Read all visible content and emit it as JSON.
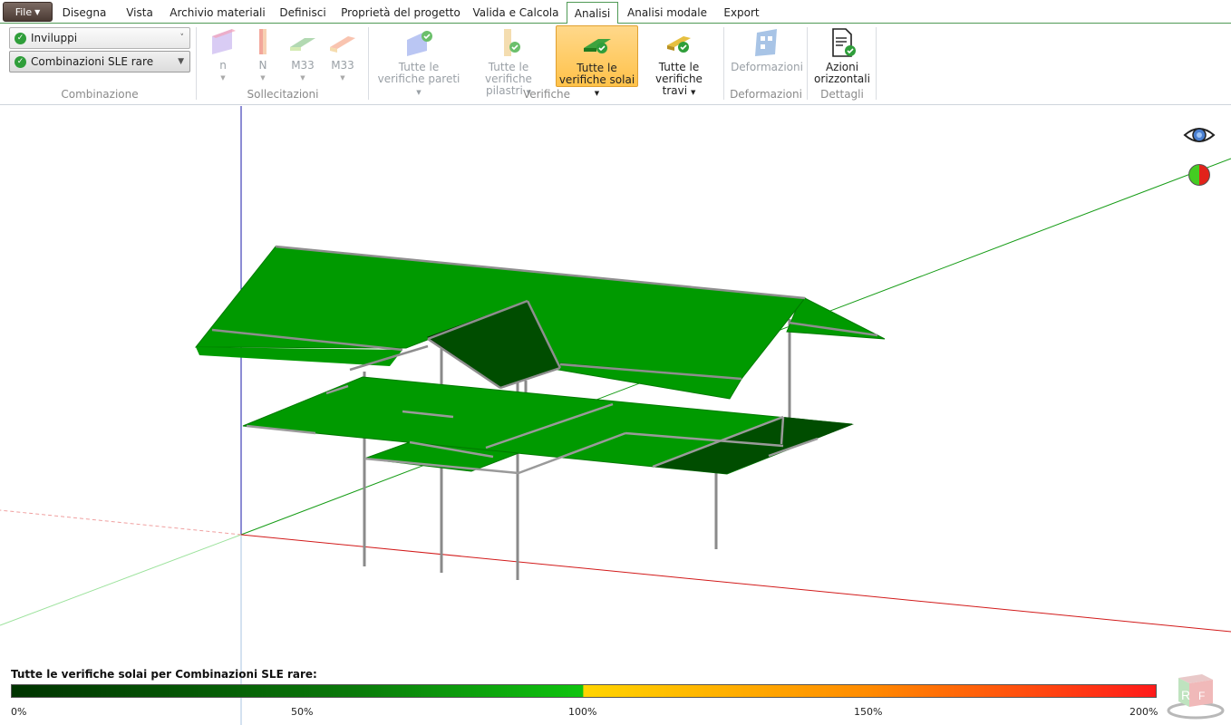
{
  "app": {
    "file_label": "File",
    "tabs": [
      {
        "label": "Disegna"
      },
      {
        "label": "Vista"
      },
      {
        "label": "Archivio materiali"
      },
      {
        "label": "Definisci"
      },
      {
        "label": "Proprietà del progetto"
      },
      {
        "label": "Valida e Calcola"
      },
      {
        "label": "Analisi",
        "active": true
      },
      {
        "label": "Analisi modale"
      },
      {
        "label": "Export"
      }
    ]
  },
  "ribbon": {
    "combinazione": {
      "envelope_select": "Inviluppi",
      "combination_select": "Combinazioni SLE rare",
      "group_label": "Combinazione"
    },
    "sollecitazioni": {
      "buttons": [
        "n",
        "N",
        "M33",
        "M33"
      ],
      "group_label": "Sollecitazioni"
    },
    "verifiche": {
      "walls": [
        "Tutte le",
        "verifiche pareti"
      ],
      "columns": [
        "Tutte le",
        "verifiche pilastri"
      ],
      "slabs": [
        "Tutte le",
        "verifiche solai"
      ],
      "beams": [
        "Tutte le",
        "verifiche travi"
      ],
      "group_label": "Verifiche"
    },
    "deformazioni": {
      "button": "Deformazioni",
      "group_label": "Deformazioni"
    },
    "dettagli": {
      "button": [
        "Azioni",
        "orizzontali"
      ],
      "group_label": "Dettagli"
    }
  },
  "legend": {
    "title": "Tutte le verifiche solai per Combinazioni SLE rare:",
    "ticks": [
      "0%",
      "50%",
      "100%",
      "150%",
      "200%"
    ]
  },
  "colors": {
    "accent_green": "#4f9a55",
    "slab_green": "#009a00",
    "slab_dark": "#004d00",
    "selected_button": "#ffc24a"
  },
  "icons": {
    "view_toggle": "eye-icon",
    "status": "status-indicator-icon",
    "nav_cube": "navigation-cube-icon"
  }
}
